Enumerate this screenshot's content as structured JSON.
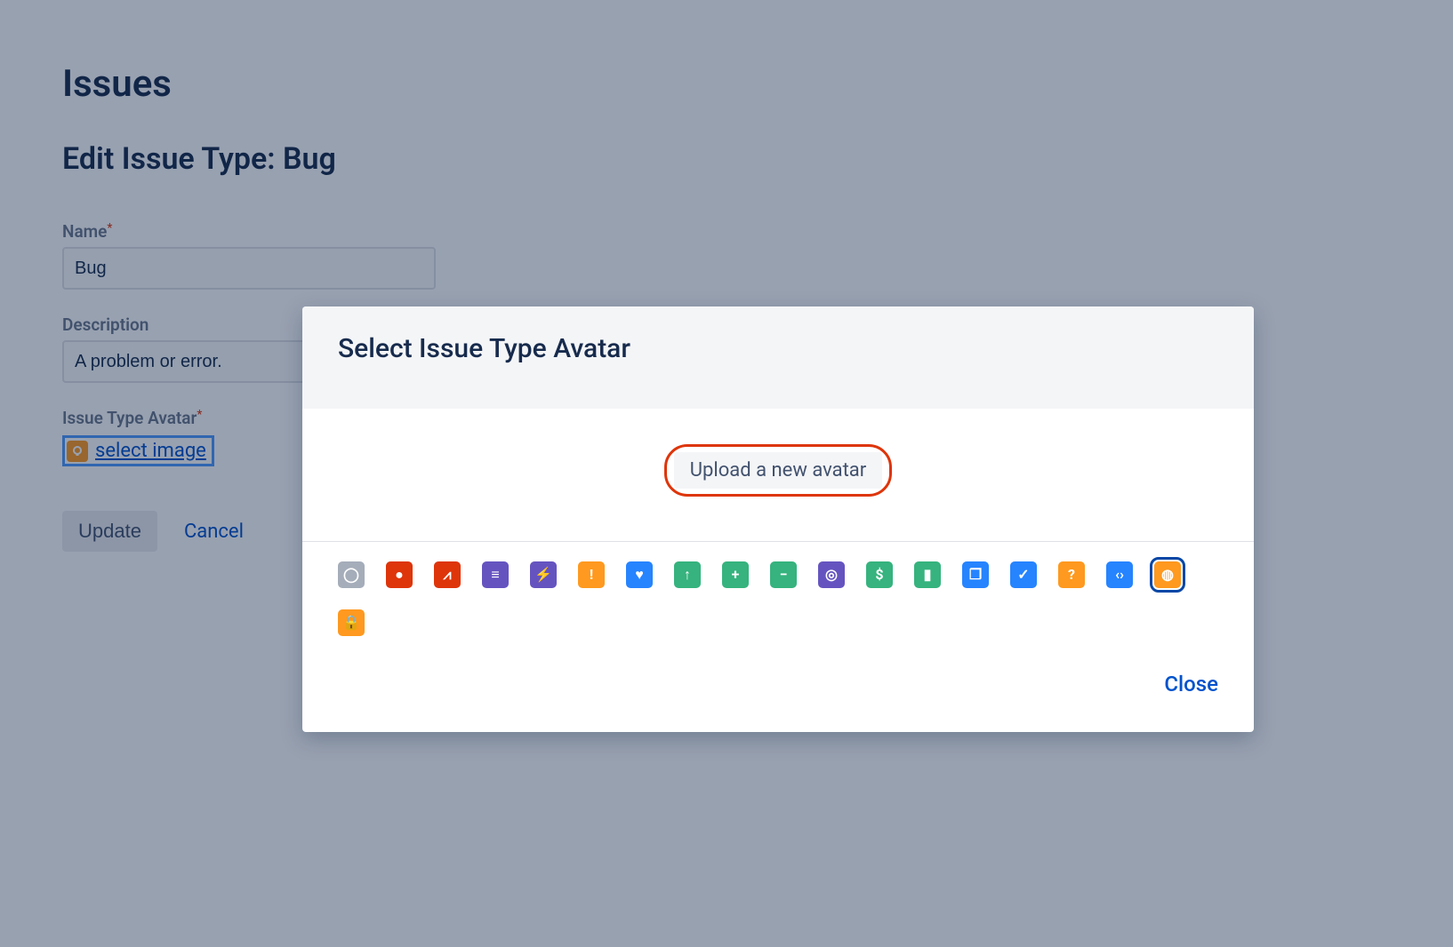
{
  "page": {
    "heading": "Issues",
    "subheading": "Edit Issue Type: Bug",
    "name_label": "Name",
    "name_value": "Bug",
    "desc_label": "Description",
    "desc_value": "A problem or error.",
    "avatar_label": "Issue Type Avatar",
    "select_image_link": "select image",
    "update_btn": "Update",
    "cancel_btn": "Cancel"
  },
  "dialog": {
    "title": "Select Issue Type Avatar",
    "upload_label": "Upload a new avatar",
    "close_label": "Close",
    "avatars": [
      {
        "name": "circle-icon",
        "bg": "#A5ADBA",
        "glyph": "◯"
      },
      {
        "name": "record-icon",
        "bg": "#DE350B",
        "glyph": "●"
      },
      {
        "name": "pulse-icon",
        "bg": "#DE350B",
        "glyph": "⩘"
      },
      {
        "name": "lines-icon",
        "bg": "#6554C0",
        "glyph": "≡"
      },
      {
        "name": "bolt-icon",
        "bg": "#6554C0",
        "glyph": "⚡"
      },
      {
        "name": "warning-icon",
        "bg": "#FF991F",
        "glyph": "!"
      },
      {
        "name": "heart-icon",
        "bg": "#2684FF",
        "glyph": "♥"
      },
      {
        "name": "arrow-up-icon",
        "bg": "#36B37E",
        "glyph": "↑"
      },
      {
        "name": "plus-icon",
        "bg": "#36B37E",
        "glyph": "+"
      },
      {
        "name": "minus-icon",
        "bg": "#36B37E",
        "glyph": "−"
      },
      {
        "name": "target-icon",
        "bg": "#6554C0",
        "glyph": "◎"
      },
      {
        "name": "dollar-icon",
        "bg": "#36B37E",
        "glyph": "$"
      },
      {
        "name": "bookmark-icon",
        "bg": "#36B37E",
        "glyph": "▮"
      },
      {
        "name": "copy-icon",
        "bg": "#2684FF",
        "glyph": "❐"
      },
      {
        "name": "check-icon",
        "bg": "#2684FF",
        "glyph": "✓"
      },
      {
        "name": "question-icon",
        "bg": "#FF991F",
        "glyph": "?"
      },
      {
        "name": "code-icon",
        "bg": "#2684FF",
        "glyph": "‹›"
      },
      {
        "name": "bulb-icon",
        "bg": "#FF991F",
        "glyph": "◍",
        "selected": true
      },
      {
        "name": "lock-icon",
        "bg": "#FF991F",
        "glyph": "🔒"
      }
    ]
  }
}
